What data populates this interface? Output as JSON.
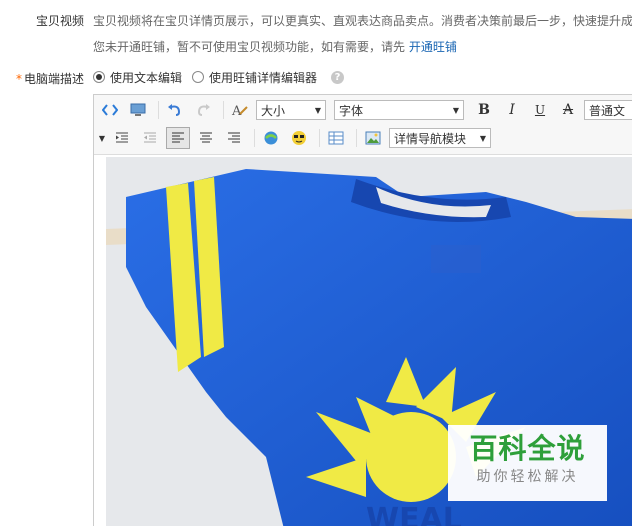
{
  "video": {
    "label": "宝贝视频",
    "desc_line1": "宝贝视频将在宝贝详情页展示，可以更真实、直观表达商品卖点。消费者决策前最后一步，快速提升成",
    "desc_line2_prefix": "您未开通旺铺，暂不可使用宝贝视频功能，如有需要，请先",
    "desc_line2_link": "开通旺铺"
  },
  "pc_desc": {
    "label": "电脑端描述",
    "asterisk": "*",
    "options": [
      {
        "label": "使用文本编辑",
        "checked": true
      },
      {
        "label": "使用旺铺详情编辑器",
        "checked": false
      }
    ],
    "help": "?"
  },
  "toolbar": {
    "size_select": "大小",
    "font_select": "字体",
    "bold": "B",
    "italic": "I",
    "underline": "U",
    "strike": "A",
    "format_select": "普通文",
    "module_select": "详情导航模块"
  },
  "watermark": {
    "title": "百科全说",
    "subtitle": "助你轻松解决"
  },
  "colors": {
    "link": "#1a66b3",
    "asterisk": "#ff6600",
    "shirt": "#1a5fd6",
    "stripe": "#f0ea45",
    "watermark_green": "#2e9f3a"
  }
}
